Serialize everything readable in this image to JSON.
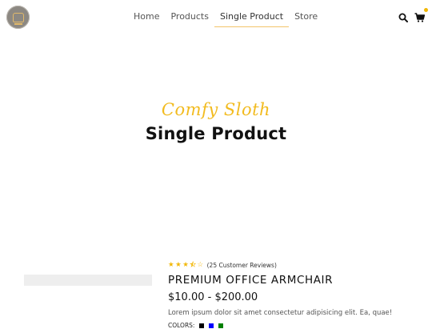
{
  "nav": {
    "logo_name": "logo-chair-icon",
    "links": [
      {
        "label": "Home",
        "active": false
      },
      {
        "label": "Products",
        "active": false
      },
      {
        "label": "Single Product",
        "active": true
      },
      {
        "label": "Store",
        "active": false
      }
    ],
    "search_icon": "search-icon",
    "cart_icon": "cart-icon"
  },
  "hero": {
    "tagline": "Comfy Sloth",
    "title": "Single Product"
  },
  "product": {
    "rating": 3.5,
    "rating_max": 5,
    "reviews_text": "(25 Customer Reviews)",
    "name": "PREMIUM OFFICE ARMCHAIR",
    "price": "$10.00 - $200.00",
    "description": "Lorem ipsum dolor sit amet consectetur adipisicing elit. Ea, quae!",
    "colors_label": "COLORS:",
    "colors": [
      "#000000",
      "#0000ff",
      "#008000"
    ]
  },
  "theme": {
    "accent": "#f2bb1f",
    "active_underline": "#f2c46b"
  }
}
